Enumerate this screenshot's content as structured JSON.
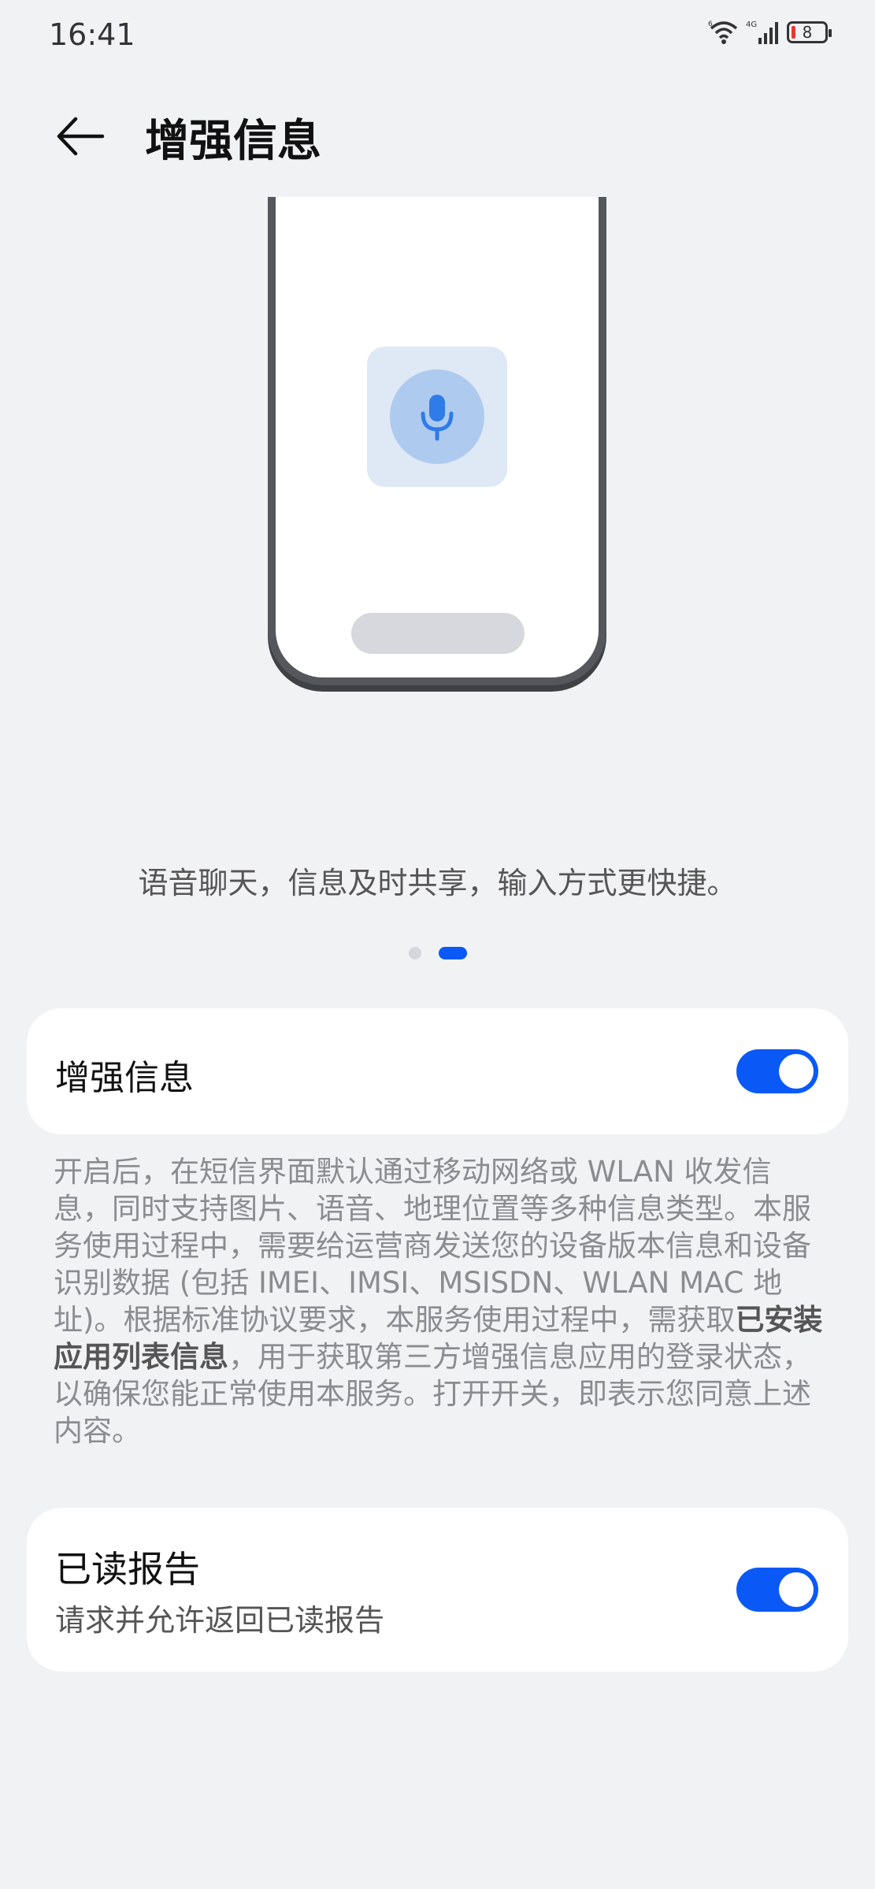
{
  "status_bar": {
    "time": "16:41",
    "battery_level": "8",
    "network": "4G"
  },
  "header": {
    "title": "增强信息"
  },
  "illustration": {
    "caption": "语音聊天，信息及时共享，输入方式更快捷。",
    "pager_pages": 2,
    "pager_active": 2
  },
  "enhanced_card": {
    "title": "增强信息",
    "toggle_on": true
  },
  "description": {
    "part1": "开启后，在短信界面默认通过移动网络或 WLAN 收发信息，同时支持图片、语音、地理位置等多种信息类型。本服务使用过程中，需要给运营商发送您的设备版本信息和设备识别数据 (包括 IMEI、IMSI、MSISDN、WLAN MAC 地址)。根据标准协议要求，本服务使用过程中，需获取",
    "bold": "已安装应用列表信息",
    "part2": "，用于获取第三方增强信息应用的登录状态，以确保您能正常使用本服务。打开开关，即表示您同意上述内容。"
  },
  "read_report_card": {
    "title": "已读报告",
    "subtitle": "请求并允许返回已读报告",
    "toggle_on": true
  },
  "colors": {
    "accent": "#0a59f7",
    "background": "#f1f2f4"
  }
}
